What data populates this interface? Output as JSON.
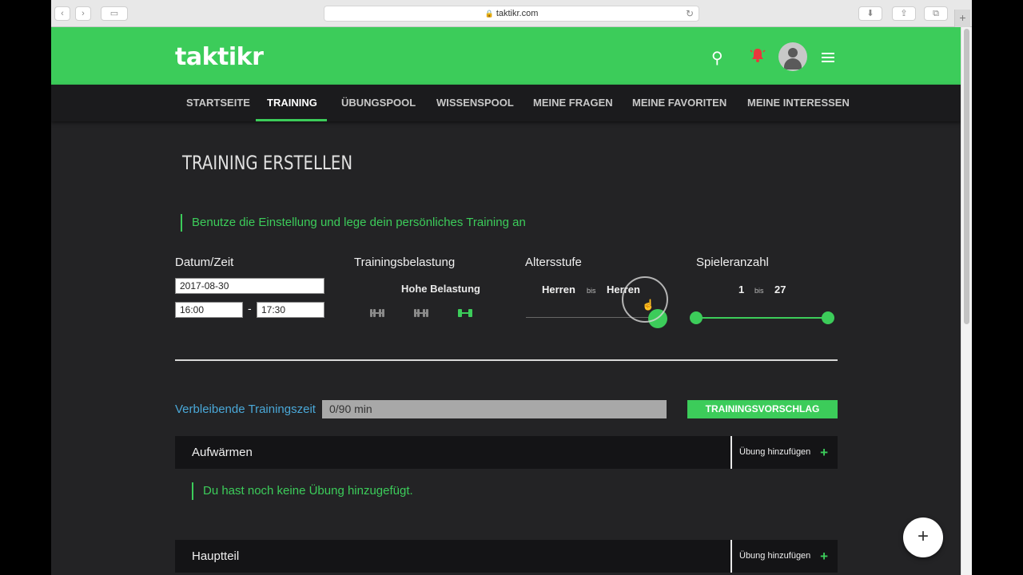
{
  "browser": {
    "url": "taktikr.com",
    "back_glyph": "‹",
    "forward_glyph": "›",
    "sidebar_glyph": "▭",
    "reload_glyph": "↻",
    "download_glyph": "⬇",
    "share_glyph": "⇪",
    "tabs_glyph": "⧉",
    "newtab_glyph": "+"
  },
  "header": {
    "logo": "taktikr",
    "icons": [
      "search-icon",
      "bell-icon",
      "avatar",
      "menu-icon"
    ],
    "bell_color": "#e8383d",
    "search_glyph": "⚲",
    "bell_glyph": "🔔"
  },
  "nav": {
    "items": [
      {
        "label": "STARTSEITE",
        "active": false
      },
      {
        "label": "TRAINING",
        "active": true
      },
      {
        "label": "ÜBUNGSPOOL",
        "active": false
      },
      {
        "label": "WISSENSPOOL",
        "active": false
      },
      {
        "label": "MEINE FRAGEN",
        "active": false
      },
      {
        "label": "MEINE FAVORITEN",
        "active": false
      },
      {
        "label": "MEINE INTERESSEN",
        "active": false
      }
    ]
  },
  "main": {
    "title": "TRAINING ERSTELLEN",
    "hint": "Benutze die Einstellung und lege dein persönliches Training an",
    "datetime": {
      "label": "Datum/Zeit",
      "date": "2017-08-30",
      "time_from": "16:00",
      "time_to": "17:30",
      "separator": "-"
    },
    "load": {
      "label": "Trainingsbelastung",
      "value": "Hohe Belastung",
      "levels": 3,
      "selected_level": 3
    },
    "age": {
      "label": "Altersstufe",
      "from": "Herren",
      "bis": "bis",
      "to": "Herren"
    },
    "players": {
      "label": "Spieleranzahl",
      "from": "1",
      "bis": "bis",
      "to": "27"
    },
    "remaining": {
      "label": "Verbleibende Trainingszeit",
      "value": "0/90 min",
      "progress": 0
    },
    "suggest_button": "TRAININGSVORSCHLAG",
    "sections": [
      {
        "name": "Aufwärmen",
        "add_label": "Übung hinzufügen",
        "empty_text": "Du hast noch keine Übung hinzugefügt."
      },
      {
        "name": "Hauptteil",
        "add_label": "Übung hinzufügen"
      }
    ],
    "fab_glyph": "+",
    "plus_glyph": "+"
  },
  "colors": {
    "brand_green": "#3ccc5a",
    "remaining_label_blue": "#4aa8d8",
    "background": "#232325"
  }
}
